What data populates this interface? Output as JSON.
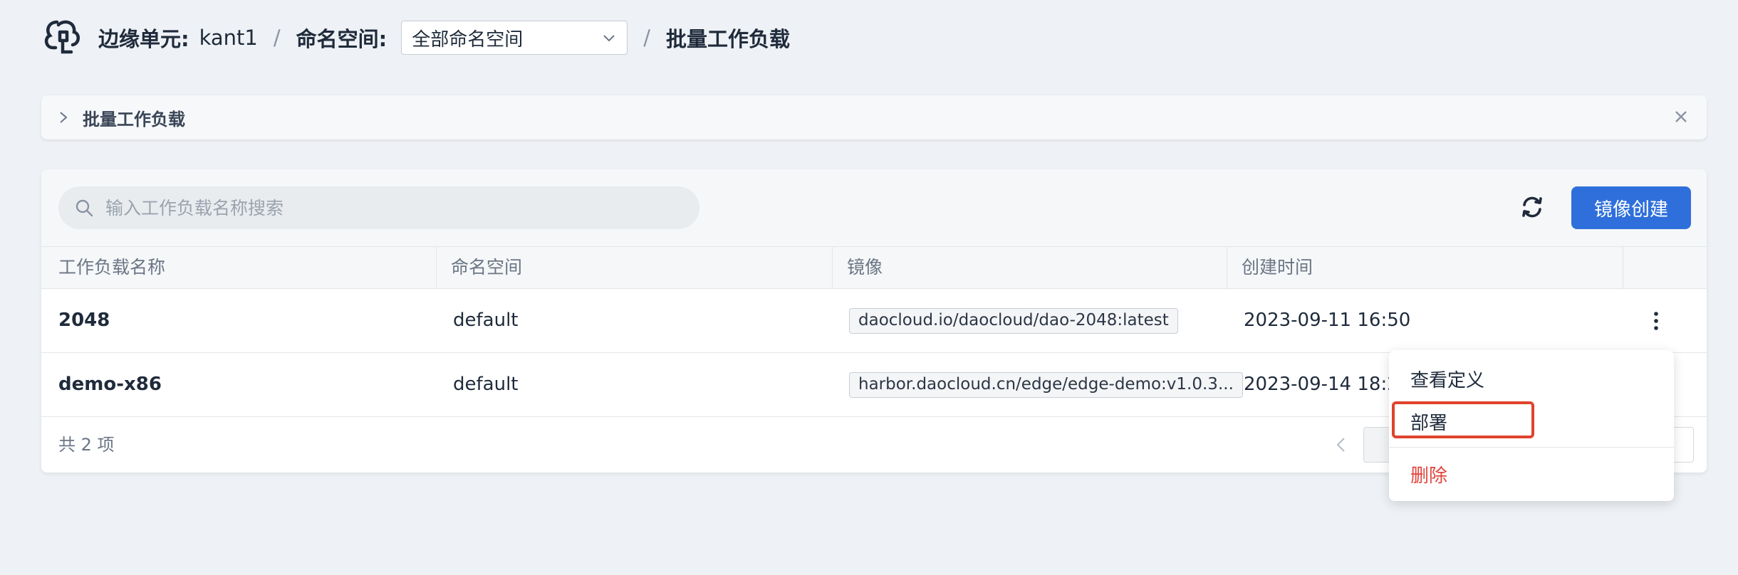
{
  "header": {
    "edge_unit_label": "边缘单元:",
    "edge_unit_value": "kant1",
    "sep1": "/",
    "namespace_label": "命名空间:",
    "namespace_selected": "全部命名空间",
    "sep2": "/",
    "page_title": "批量工作负载"
  },
  "collapse_bar": {
    "label": "批量工作负载"
  },
  "toolbar": {
    "search_placeholder": "输入工作负载名称搜索",
    "create_label": "镜像创建"
  },
  "table": {
    "columns": [
      "工作负载名称",
      "命名空间",
      "镜像",
      "创建时间"
    ],
    "rows": [
      {
        "name": "2048",
        "namespace": "default",
        "image": "daocloud.io/daocloud/dao-2048:latest",
        "created": "2023-09-11 16:50"
      },
      {
        "name": "demo-x86",
        "namespace": "default",
        "image": "harbor.daocloud.cn/edge/edge-demo:v1.0.3...",
        "created": "2023-09-14 18:2"
      }
    ]
  },
  "footer": {
    "total": "共 2 项"
  },
  "menu": {
    "items": [
      "查看定义",
      "部署",
      "删除"
    ]
  },
  "colors": {
    "primary": "#2f6fdb",
    "danger": "#e0443d",
    "highlight": "#e0432c"
  }
}
